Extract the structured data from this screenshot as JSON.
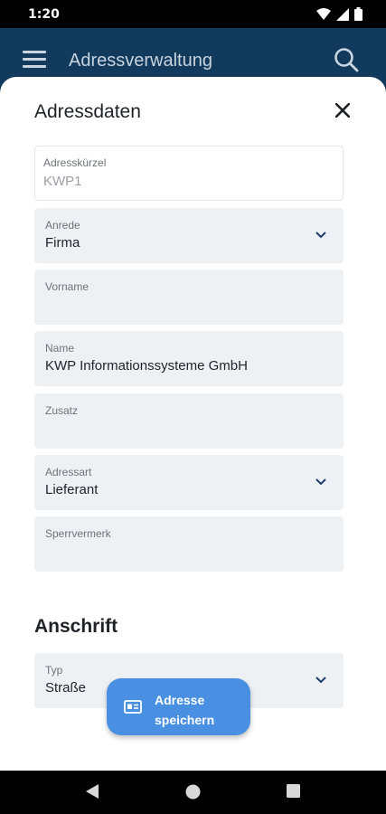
{
  "status_bar": {
    "time": "1:20"
  },
  "app_bar": {
    "title": "Adressverwaltung"
  },
  "sheet": {
    "title": "Adressdaten"
  },
  "fields": {
    "adresskuerzel": {
      "label": "Adresskürzel",
      "value": "KWP1"
    },
    "anrede": {
      "label": "Anrede",
      "value": "Firma"
    },
    "vorname": {
      "label": "Vorname",
      "value": ""
    },
    "name": {
      "label": "Name",
      "value": "KWP Informationssysteme GmbH"
    },
    "zusatz": {
      "label": "Zusatz",
      "value": ""
    },
    "adressart": {
      "label": "Adressart",
      "value": "Lieferant"
    },
    "sperrvermerk": {
      "label": "Sperrvermerk",
      "value": ""
    }
  },
  "anschrift": {
    "title": "Anschrift",
    "typ": {
      "label": "Typ",
      "value": "Straße"
    }
  },
  "fab": {
    "label": "Adresse speichern",
    "icon": "contact-card-icon"
  },
  "colors": {
    "app_bar": "#123a5c",
    "fab": "#4a90e2",
    "field_bg": "#eef1f4"
  }
}
